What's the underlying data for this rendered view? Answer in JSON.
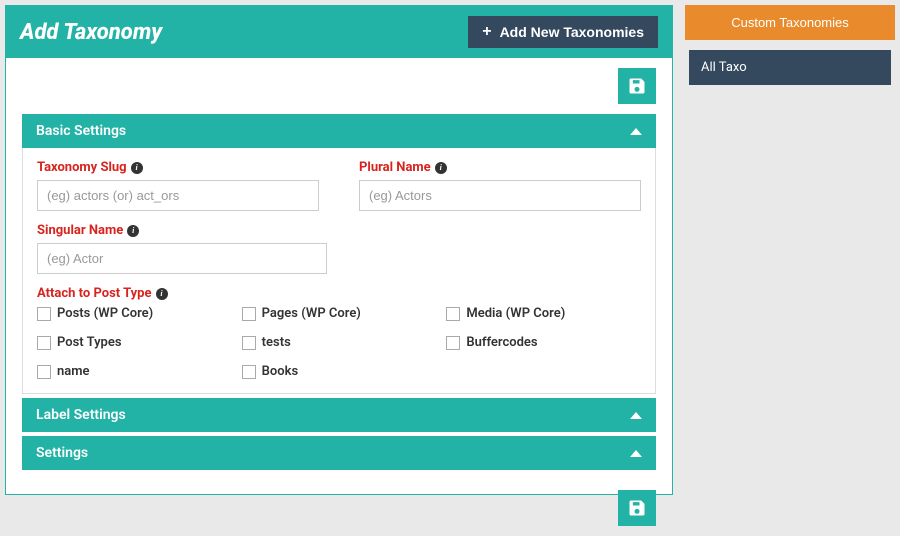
{
  "header": {
    "title": "Add Taxonomy",
    "add_button": "Add New Taxonomies"
  },
  "panels": {
    "basic": {
      "title": "Basic Settings",
      "slug_label": "Taxonomy Slug",
      "slug_placeholder": "(eg) actors (or) act_ors",
      "plural_label": "Plural Name",
      "plural_placeholder": "(eg) Actors",
      "singular_label": "Singular Name",
      "singular_placeholder": "(eg) Actor",
      "attach_label": "Attach to Post Type",
      "post_types": [
        "Posts (WP Core)",
        "Pages (WP Core)",
        "Media (WP Core)",
        "Post Types",
        "tests",
        "Buffercodes",
        "name",
        "Books"
      ]
    },
    "labels": {
      "title": "Label Settings"
    },
    "settings": {
      "title": "Settings"
    }
  },
  "sidebar": {
    "custom_tax": "Custom Taxonomies",
    "all_taxo": "All Taxo"
  }
}
